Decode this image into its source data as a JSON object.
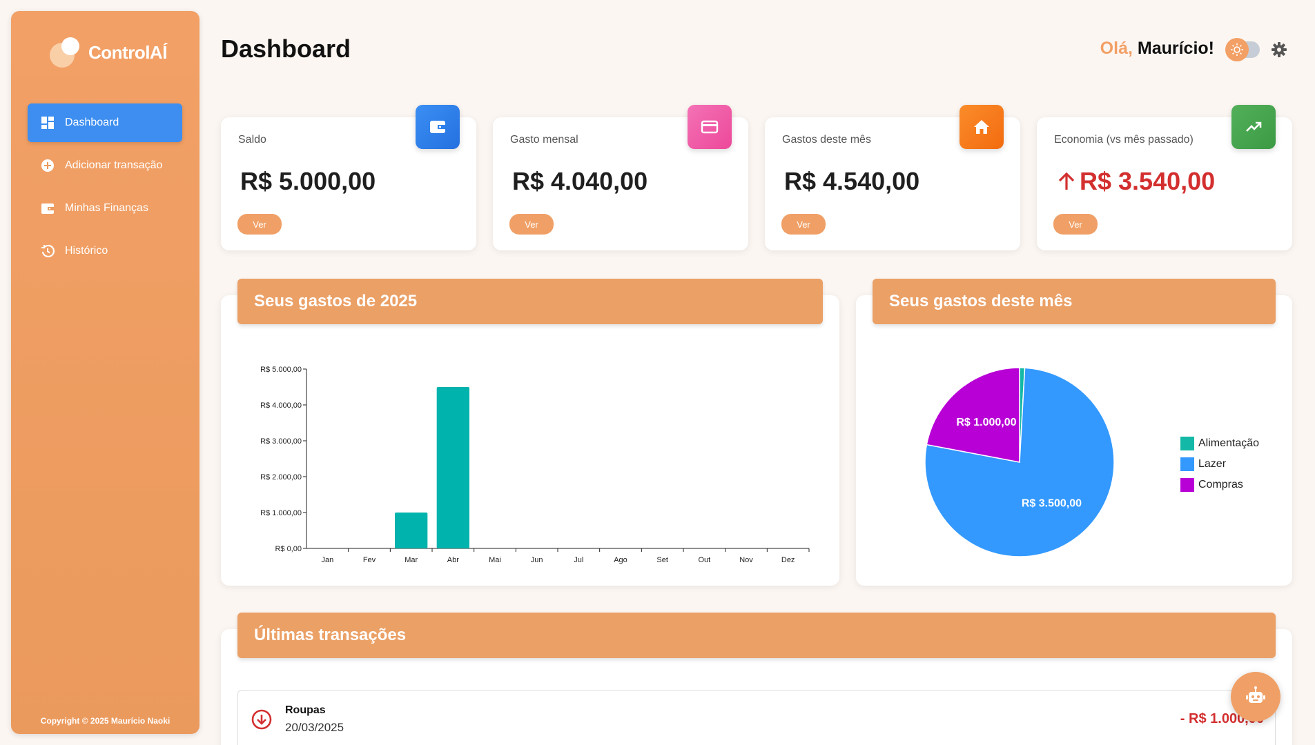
{
  "brand": {
    "name": "ControlAÍ"
  },
  "sidebar": {
    "items": [
      {
        "label": "Dashboard",
        "icon": "dashboard-icon",
        "active": true
      },
      {
        "label": "Adicionar transação",
        "icon": "plus-circle-icon",
        "active": false
      },
      {
        "label": "Minhas Finanças",
        "icon": "wallet-icon",
        "active": false
      },
      {
        "label": "Histórico",
        "icon": "history-icon",
        "active": false
      }
    ],
    "copyright": "Copyright © 2025 Maurício Naoki"
  },
  "header": {
    "title": "Dashboard",
    "greeting_prefix": "Olá,",
    "greeting_name": "Maurício!"
  },
  "cards": [
    {
      "label": "Saldo",
      "value": "R$ 5.000,00",
      "button": "Ver",
      "icon": "wallet-icon",
      "color": "#2f80ed"
    },
    {
      "label": "Gasto mensal",
      "value": "R$ 4.040,00",
      "button": "Ver",
      "icon": "credit-card-icon",
      "color": "#ec4899"
    },
    {
      "label": "Gastos deste mês",
      "value": "R$ 4.540,00",
      "button": "Ver",
      "icon": "home-icon",
      "color": "#f97316"
    },
    {
      "label": "Economia (vs mês passado)",
      "value": "R$ 3.540,00",
      "button": "Ver",
      "icon": "trending-up-icon",
      "color": "#43a047",
      "trend": "up"
    }
  ],
  "panels": {
    "yearly": {
      "title": "Seus gastos de 2025"
    },
    "monthly": {
      "title": "Seus gastos deste mês"
    },
    "transactions": {
      "title": "Últimas transações"
    }
  },
  "chart_data": [
    {
      "type": "bar",
      "categories": [
        "Jan",
        "Fev",
        "Mar",
        "Abr",
        "Mai",
        "Jun",
        "Jul",
        "Ago",
        "Set",
        "Out",
        "Nov",
        "Dez"
      ],
      "values": [
        0,
        0,
        1000,
        4500,
        0,
        0,
        0,
        0,
        0,
        0,
        0,
        0
      ],
      "ylim": [
        0,
        5000
      ],
      "yticks": [
        0,
        1000,
        2000,
        3000,
        4000,
        5000
      ],
      "ytick_labels": [
        "R$ 0,00",
        "R$ 1.000,00",
        "R$ 2.000,00",
        "R$ 3.000,00",
        "R$ 4.000,00",
        "R$ 5.000,00"
      ],
      "color": "#00b3ad"
    },
    {
      "type": "pie",
      "labels": [
        "Alimentação",
        "Lazer",
        "Compras"
      ],
      "values": [
        40,
        3500,
        1000
      ],
      "colors": [
        "#14b8a6",
        "#3399ff",
        "#b800d6"
      ],
      "data_labels": [
        "",
        "R$ 3.500,00",
        "R$ 1.000,00"
      ],
      "legend": "right"
    }
  ],
  "transactions": [
    {
      "title": "Roupas",
      "date": "20/03/2025",
      "amount": "- R$ 1.000,00"
    }
  ]
}
